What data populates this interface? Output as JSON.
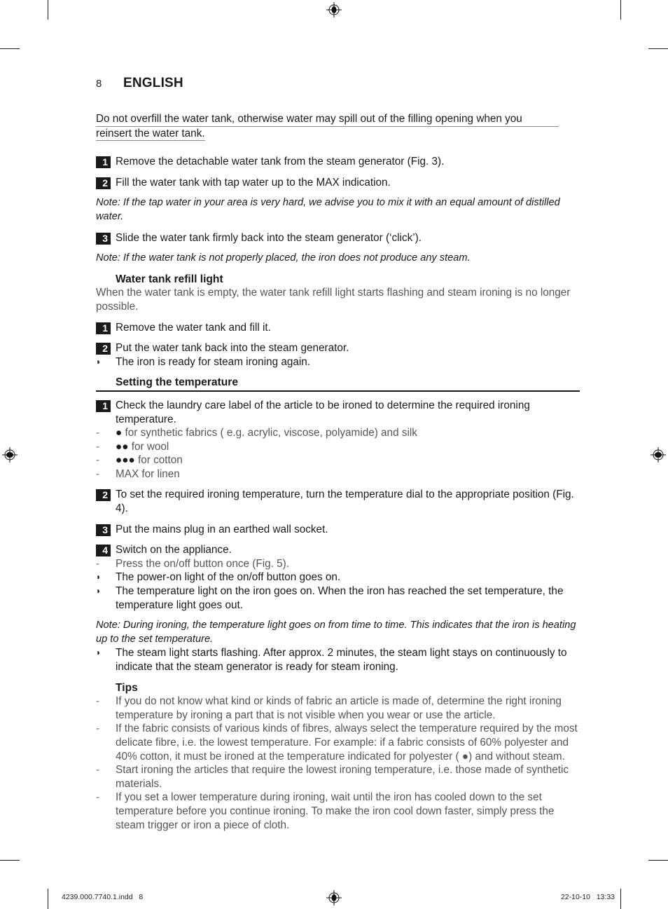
{
  "header": {
    "page_number": "8",
    "language": "ENGLISH"
  },
  "warning": {
    "line1": "Do not overfill the water tank, otherwise water may spill out of the filling opening when you",
    "line2": "reinsert the water tank."
  },
  "fill_steps": [
    {
      "num": "1",
      "text": "Remove the detachable water tank from the steam generator (Fig. 3)."
    },
    {
      "num": "2",
      "text": "Fill the water tank with tap water up to the MAX indication."
    }
  ],
  "note1": "Note: If the tap water in your area is very hard, we advise you to mix it with an equal amount of distilled water.",
  "fill_step3": {
    "num": "3",
    "text": "Slide the water tank firmly back into the steam generator (‘click’)."
  },
  "note2": "Note: If the water tank is not properly placed, the iron does not produce any steam.",
  "refill_section": {
    "title": "Water tank refill light",
    "intro": "When the water tank is empty, the water tank refill light starts flashing and steam ironing is no longer possible.",
    "steps": [
      {
        "num": "1",
        "text": "Remove the water tank and fill it."
      },
      {
        "num": "2",
        "text": "Put the water tank back into the steam generator."
      }
    ],
    "result": "The iron is ready for steam ironing again."
  },
  "temperature_section": {
    "title": "Setting the temperature",
    "step1": {
      "num": "1",
      "text": "Check the laundry care label of the article to be ironed to determine the required ironing temperature."
    },
    "settings": [
      {
        "dots": "●",
        "text": " for synthetic fabrics ( e.g. acrylic, viscose, polyamide) and silk"
      },
      {
        "dots": "●●",
        "text": " for wool"
      },
      {
        "dots": "●●●",
        "text": " for cotton"
      },
      {
        "dots": "",
        "text": "MAX for linen"
      }
    ],
    "step2": {
      "num": "2",
      "text": "To set the required ironing temperature, turn the temperature dial to the appropriate position (Fig. 4)."
    },
    "step3": {
      "num": "3",
      "text": "Put the mains plug in an earthed wall socket."
    },
    "step4": {
      "num": "4",
      "text": "Switch on the appliance."
    },
    "step4_sub": "Press the on/off button once (Fig. 5).",
    "step4_results": [
      "The power-on light of the on/off button goes on.",
      "The temperature light on the iron goes on. When the iron has reached the set temperature, the temperature light goes out."
    ],
    "note": "Note: During ironing, the temperature light goes on from time to time. This indicates that the iron is heating up to the set temperature.",
    "final_result": "The steam light starts flashing. After approx. 2 minutes, the steam light stays on continuously to indicate that the steam generator is ready for steam ironing."
  },
  "tips_section": {
    "title": "Tips",
    "items": [
      "If you do not know what kind or kinds of fabric an article is made of, determine the right ironing temperature by ironing a part that is not visible when you wear or use the article.",
      "If the fabric consists of various kinds of fibres, always select the temperature required by the most delicate fibre, i.e. the lowest temperature. For example: if a fabric consists of 60% polyester and 40% cotton, it must be ironed at the temperature indicated for polyester ( ●) and without steam.",
      "Start ironing the articles that require the lowest ironing temperature, i.e. those made of synthetic materials.",
      "If you set a lower temperature during ironing, wait until the iron has cooled down to the set temperature before you continue ironing. To make the iron cool down faster, simply press the steam trigger or iron a piece of cloth."
    ]
  },
  "markers": {
    "dash": "-",
    "result_bullet": "◗"
  },
  "footer": {
    "file": "4239.000.7740.1.indd   8",
    "date": "22-10-10   13:33"
  }
}
